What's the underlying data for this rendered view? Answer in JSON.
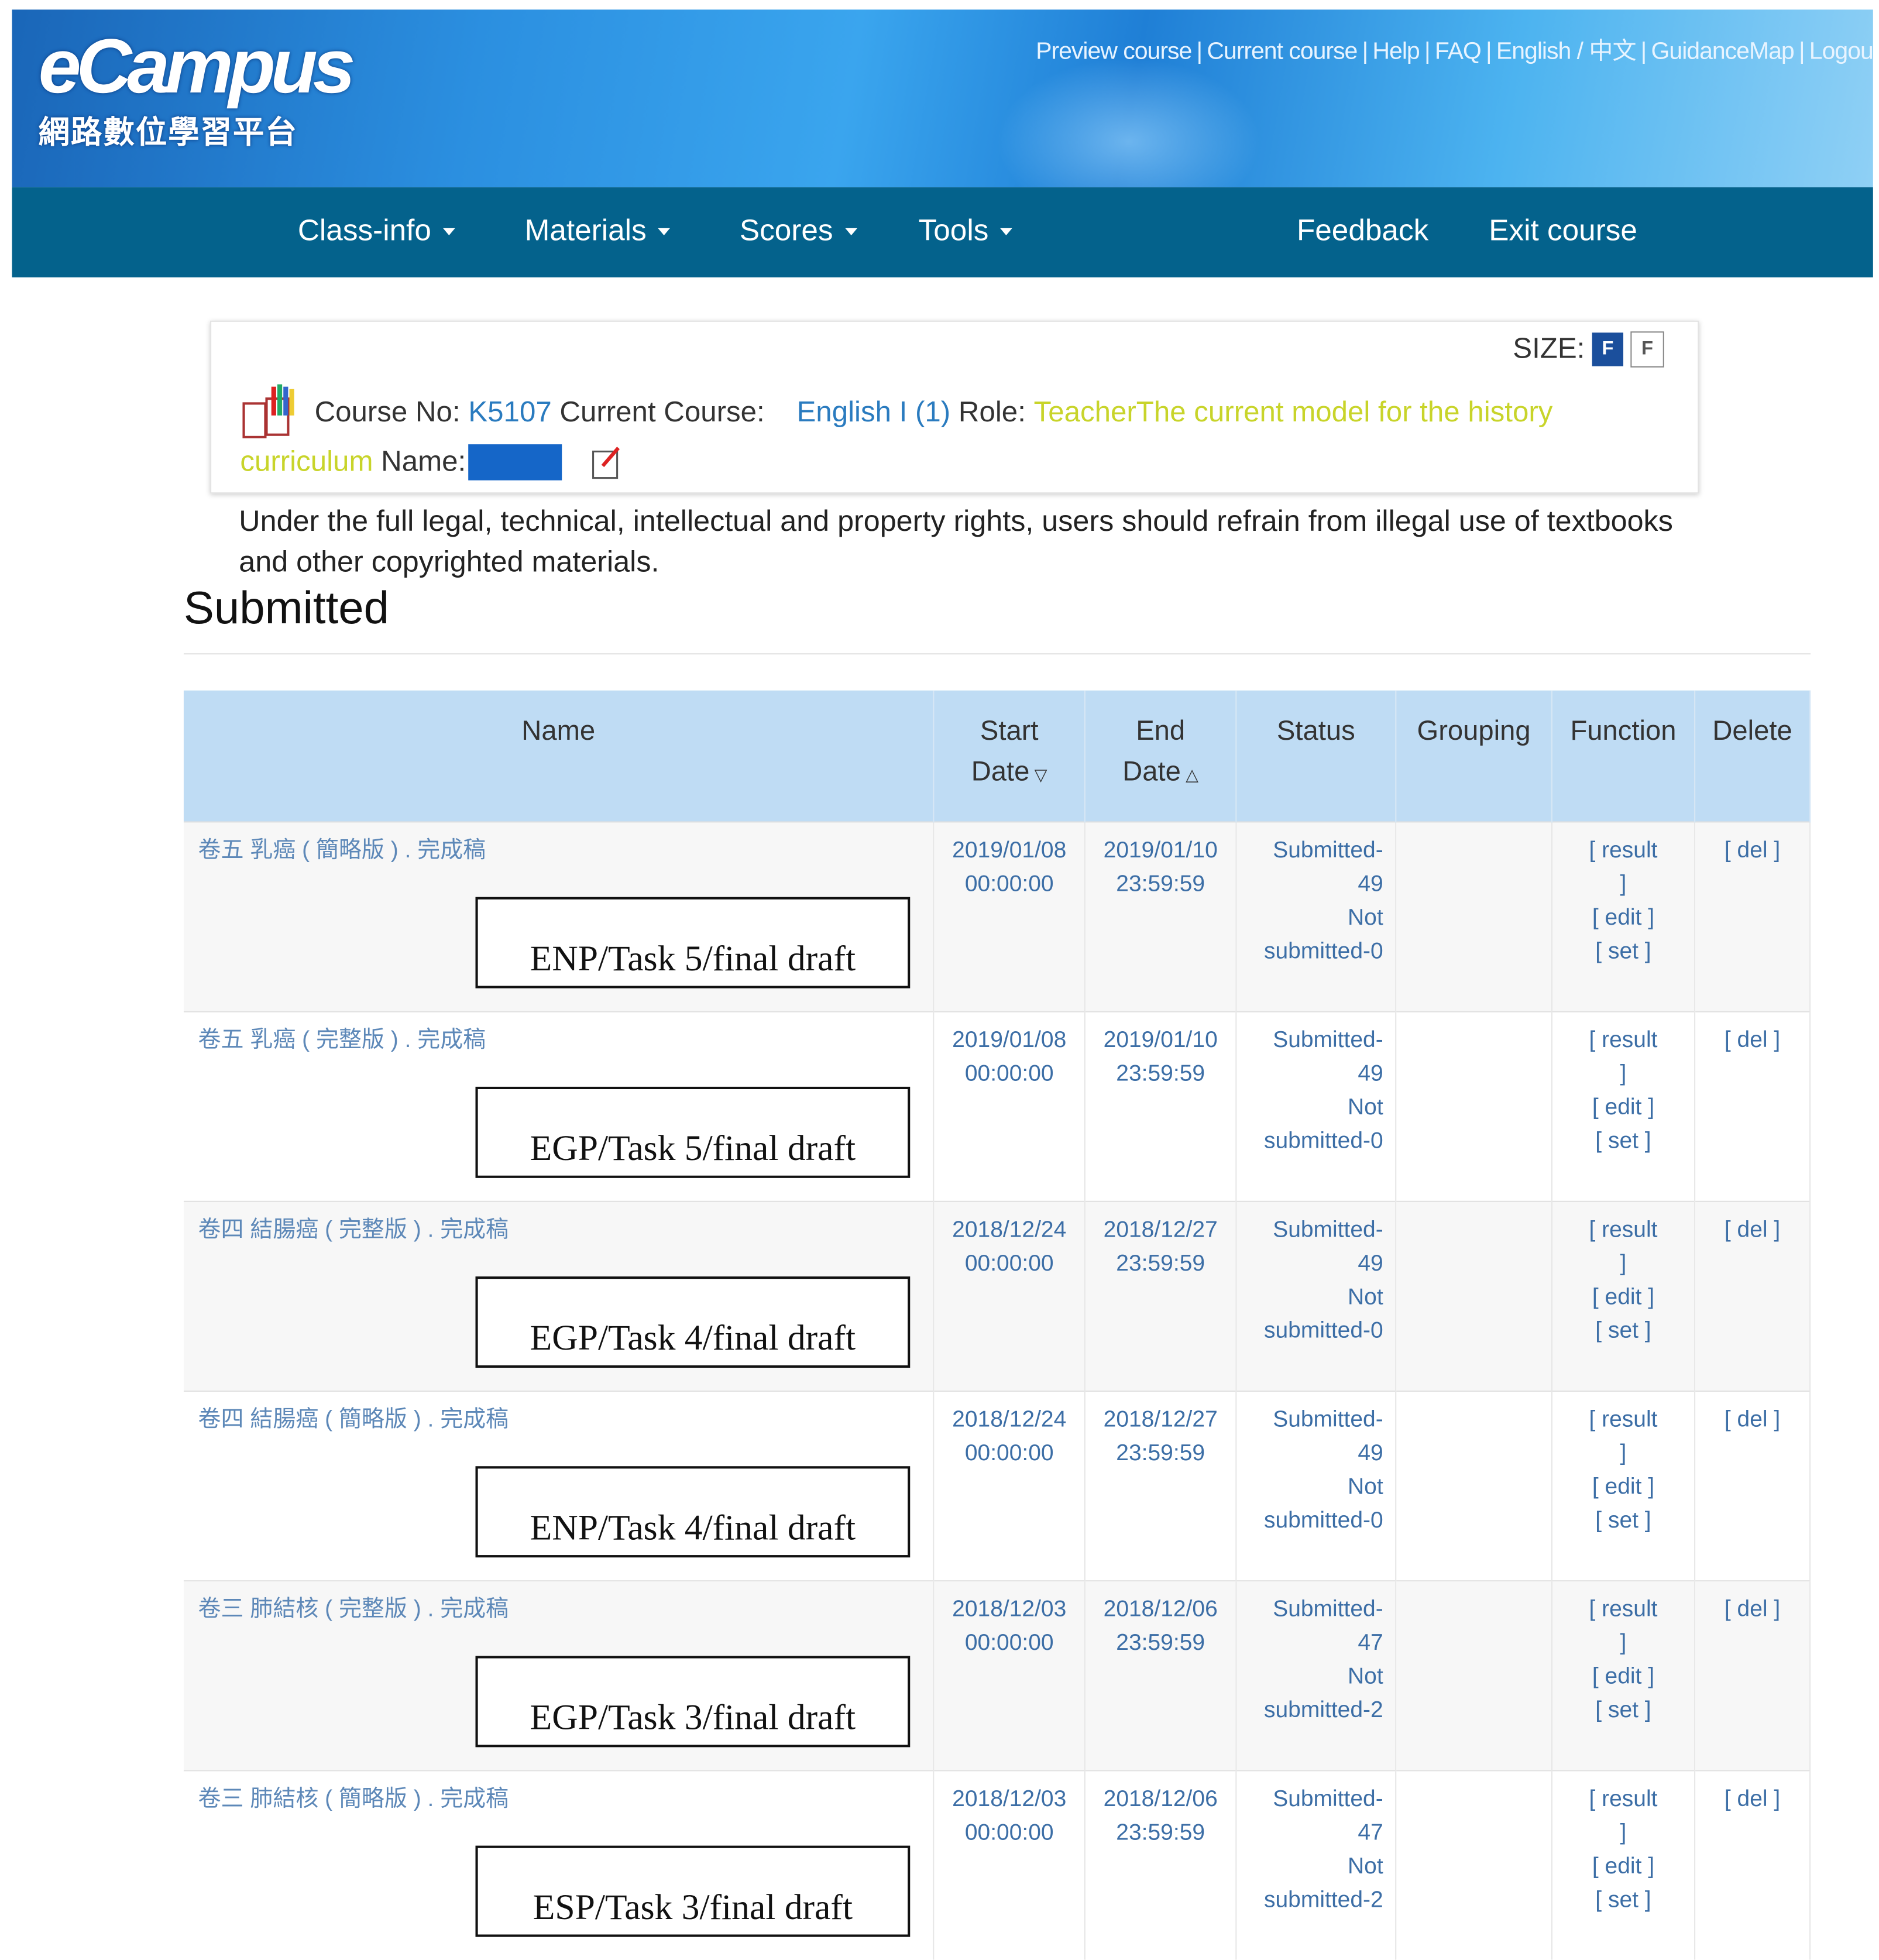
{
  "header": {
    "logo_text": "eCampus",
    "logo_subtitle": "網路數位學習平台",
    "top_links": [
      "Preview course",
      "Current course",
      "Help",
      "FAQ",
      "English / 中文",
      "GuidanceMap",
      "Logou"
    ]
  },
  "nav": {
    "items": [
      {
        "label": "Class-info"
      },
      {
        "label": "Materials"
      },
      {
        "label": "Scores"
      },
      {
        "label": "Tools"
      },
      {
        "label": "Feedback"
      },
      {
        "label": "Exit course"
      }
    ]
  },
  "course": {
    "size_label": "SIZE:",
    "size_large": "F",
    "size_small": "F",
    "course_no_label": "Course No:",
    "course_no": "K5107",
    "current_course_label": "Current Course:",
    "current_course": "English I (1)",
    "role_label": "Role:",
    "role": "TeacherThe current model for the history",
    "role_cont": "curriculum",
    "name_label": "Name:"
  },
  "notice": "Under the full legal, technical, intellectual and property rights, users should refrain from illegal use of textbooks and other copyrighted materials.",
  "page_title": "Submitted",
  "table": {
    "headers": {
      "name": "Name",
      "start": "Start",
      "start2": "Date",
      "end": "End",
      "end2": "Date",
      "status": "Status",
      "grouping": "Grouping",
      "function": "Function",
      "delete": "Delete"
    },
    "rows": [
      {
        "name": "卷五 乳癌 ( 簡略版 ) . 完成稿",
        "label": "ENP/Task 5/final draft",
        "start_date": "2019/01/08",
        "start_time": "00:00:00",
        "end_date": "2019/01/10",
        "end_time": "23:59:59",
        "submitted": "Submitted-",
        "sub_count": "49",
        "not": "Not",
        "not_sub": "submitted-0",
        "f1": "[ result",
        "f1b": "]",
        "f2": "[ edit ]",
        "f3": "[ set ]",
        "del": "[ del ]"
      },
      {
        "name": "卷五 乳癌 ( 完整版 ) . 完成稿",
        "label": "EGP/Task 5/final draft",
        "start_date": "2019/01/08",
        "start_time": "00:00:00",
        "end_date": "2019/01/10",
        "end_time": "23:59:59",
        "submitted": "Submitted-",
        "sub_count": "49",
        "not": "Not",
        "not_sub": "submitted-0",
        "f1": "[ result",
        "f1b": "]",
        "f2": "[ edit ]",
        "f3": "[ set ]",
        "del": "[ del ]"
      },
      {
        "name": "卷四 結腸癌 ( 完整版 ) . 完成稿",
        "label": "EGP/Task 4/final draft",
        "start_date": "2018/12/24",
        "start_time": "00:00:00",
        "end_date": "2018/12/27",
        "end_time": "23:59:59",
        "submitted": "Submitted-",
        "sub_count": "49",
        "not": "Not",
        "not_sub": "submitted-0",
        "f1": "[ result",
        "f1b": "]",
        "f2": "[ edit ]",
        "f3": "[ set ]",
        "del": "[ del ]"
      },
      {
        "name": "卷四 結腸癌 ( 簡略版 ) . 完成稿",
        "label": "ENP/Task 4/final draft",
        "start_date": "2018/12/24",
        "start_time": "00:00:00",
        "end_date": "2018/12/27",
        "end_time": "23:59:59",
        "submitted": "Submitted-",
        "sub_count": "49",
        "not": "Not",
        "not_sub": "submitted-0",
        "f1": "[ result",
        "f1b": "]",
        "f2": "[ edit ]",
        "f3": "[ set ]",
        "del": "[ del ]"
      },
      {
        "name": "卷三 肺結核 ( 完整版 ) . 完成稿",
        "label": "EGP/Task 3/final draft",
        "start_date": "2018/12/03",
        "start_time": "00:00:00",
        "end_date": "2018/12/06",
        "end_time": "23:59:59",
        "submitted": "Submitted-",
        "sub_count": "47",
        "not": "Not",
        "not_sub": "submitted-2",
        "f1": "[ result",
        "f1b": "]",
        "f2": "[ edit ]",
        "f3": "[ set ]",
        "del": "[ del ]"
      },
      {
        "name": "卷三 肺結核 ( 簡略版 ) . 完成稿",
        "label": "ESP/Task 3/final draft",
        "start_date": "2018/12/03",
        "start_time": "00:00:00",
        "end_date": "2018/12/06",
        "end_time": "23:59:59",
        "submitted": "Submitted-",
        "sub_count": "47",
        "not": "Not",
        "not_sub": "submitted-2",
        "f1": "[ result",
        "f1b": "]",
        "f2": "[ edit ]",
        "f3": "[ set ]",
        "del": "[ del ]"
      }
    ]
  }
}
